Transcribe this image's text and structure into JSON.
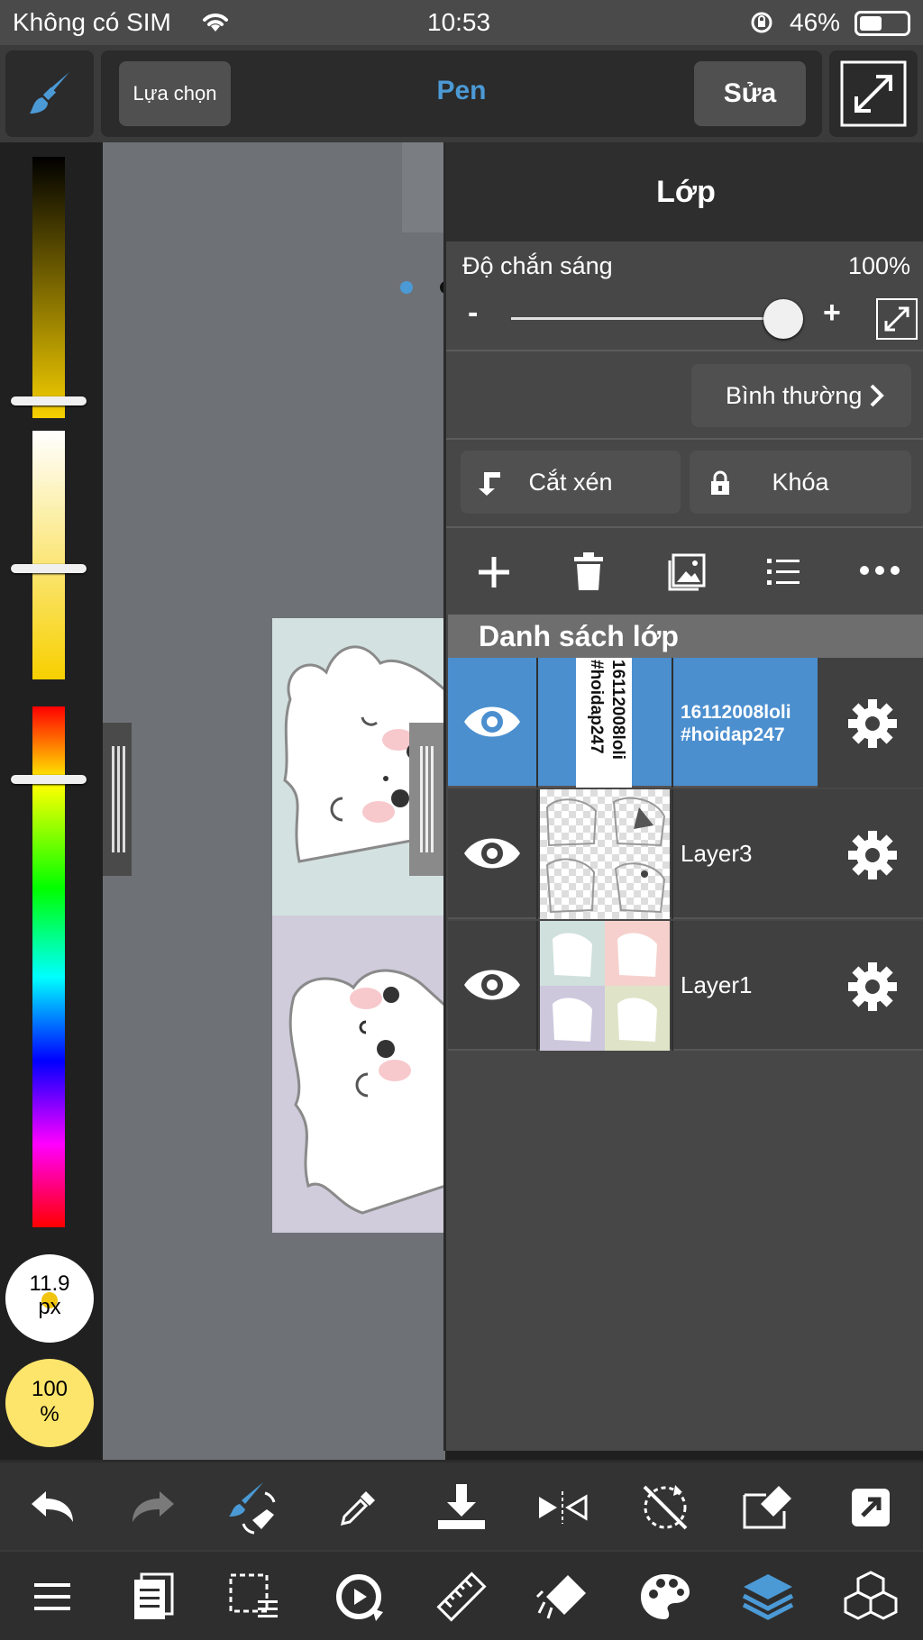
{
  "status": {
    "carrier": "Không có SIM",
    "time": "10:53",
    "battery": "46%"
  },
  "toolbar": {
    "selection_label": "Lựa chọn",
    "tool_name": "Pen",
    "edit_label": "Sửa"
  },
  "brush": {
    "size": "11.9",
    "size_unit": "px",
    "opacity": "100",
    "opacity_unit": "%"
  },
  "colors": {
    "accent": "#4b8fcf",
    "primary": "#f1c40f"
  },
  "layer_panel": {
    "title": "Lớp",
    "opacity_label": "Độ chắn sáng",
    "opacity_value": "100%",
    "opacity_fraction": 1.0,
    "minus": "-",
    "plus": "+",
    "blend_mode": "Bình thường",
    "clip_label": "Cắt xén",
    "lock_label": "Khóa",
    "list_title": "Danh sách lớp",
    "layers": [
      {
        "name_line1": "16112008loli",
        "name_line2": "#hoidap247",
        "thumb_text1": "16112008loli",
        "thumb_text2": "#hoidap247",
        "selected": true
      },
      {
        "name": "Layer3",
        "selected": false
      },
      {
        "name": "Layer1",
        "selected": false
      }
    ]
  }
}
